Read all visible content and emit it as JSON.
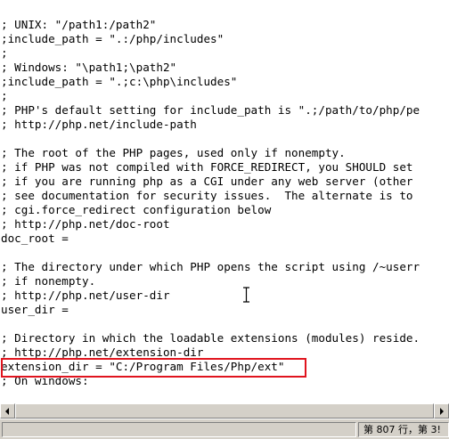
{
  "editor": {
    "lines": [
      "; UNIX: \"/path1:/path2\"",
      ";include_path = \".:/php/includes\"",
      ";",
      "; Windows: \"\\path1;\\path2\"",
      ";include_path = \".;c:\\php\\includes\"",
      ";",
      "; PHP's default setting for include_path is \".;/path/to/php/pe",
      "; http://php.net/include-path",
      "",
      "; The root of the PHP pages, used only if nonempty.",
      "; if PHP was not compiled with FORCE_REDIRECT, you SHOULD set",
      "; if you are running php as a CGI under any web server (other",
      "; see documentation for security issues.  The alternate is to",
      "; cgi.force_redirect configuration below",
      "; http://php.net/doc-root",
      "doc_root =",
      "",
      "; The directory under which PHP opens the script using /~userr",
      "; if nonempty.",
      "; http://php.net/user-dir",
      "user_dir =",
      "",
      "; Directory in which the loadable extensions (modules) reside.",
      "; http://php.net/extension-dir",
      "extension_dir = \"C:/Program Files/Php/ext\"",
      "; On windows:"
    ]
  },
  "statusbar": {
    "position_text": "第 807 行，第 3!"
  },
  "colors": {
    "highlight_border": "#e0141e",
    "editor_bg": "#ffffff",
    "chrome": "#d4d0c8"
  }
}
